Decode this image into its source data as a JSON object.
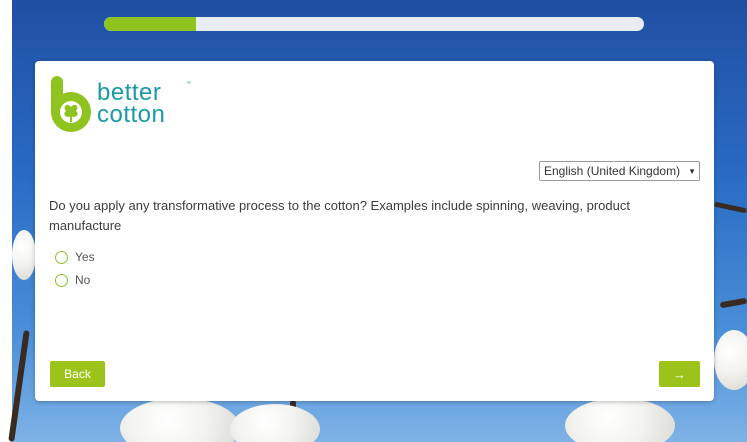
{
  "progress": {
    "fraction": 0.17
  },
  "brand": {
    "line1": "better",
    "line2": "cotton",
    "tm": "™",
    "color": "#1b9aa6",
    "accent": "#8fc31f"
  },
  "language": {
    "selected": "English (United Kingdom)"
  },
  "question": {
    "text": "Do you apply any transformative process to the cotton? Examples include spinning, weaving, product manufacture",
    "options": [
      "Yes",
      "No"
    ]
  },
  "nav": {
    "back_label": "Back",
    "next_label": "→"
  },
  "icons": {
    "logo": "better-cotton-logo-icon",
    "dropdown": "chevron-down-icon"
  }
}
